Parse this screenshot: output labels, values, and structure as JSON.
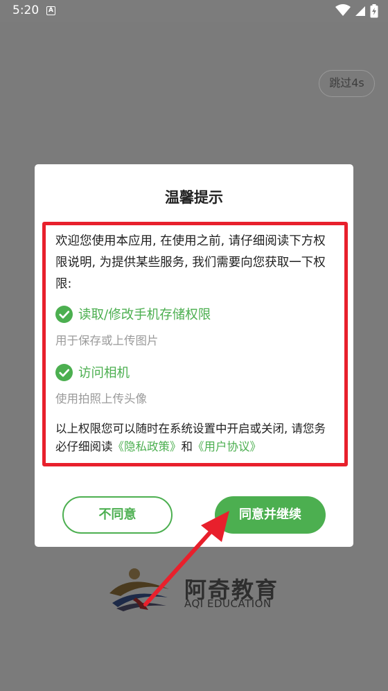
{
  "status_bar": {
    "time": "5:20",
    "notification_letter": "A",
    "icons": [
      "wifi-icon",
      "signal-icon",
      "battery-charging-icon"
    ]
  },
  "splash": {
    "skip_label": "跳过4s",
    "brand_name": "阿奇教育",
    "brand_subname": "AQI EDUCATION"
  },
  "dialog": {
    "title": "温馨提示",
    "intro": "欢迎您使用本应用, 在使用之前, 请仔细阅读下方权限说明, 为提供某些服务, 我们需要向您获取一下权限:",
    "permissions": [
      {
        "title": "读取/修改手机存储权限",
        "description": "用于保存或上传图片"
      },
      {
        "title": "访问相机",
        "description": "使用拍照上传头像"
      }
    ],
    "outro_prefix": "以上权限您可以随时在系统设置中开启或关闭, 请您务必仔细阅读",
    "privacy_link": "《隐私政策》",
    "outro_and": "和",
    "agreement_link": "《用户协议》",
    "disagree_label": "不同意",
    "agree_label": "同意并继续"
  },
  "colors": {
    "accent": "#4caf50",
    "highlight": "#e8202c",
    "overlay": "#7b7b7b"
  }
}
